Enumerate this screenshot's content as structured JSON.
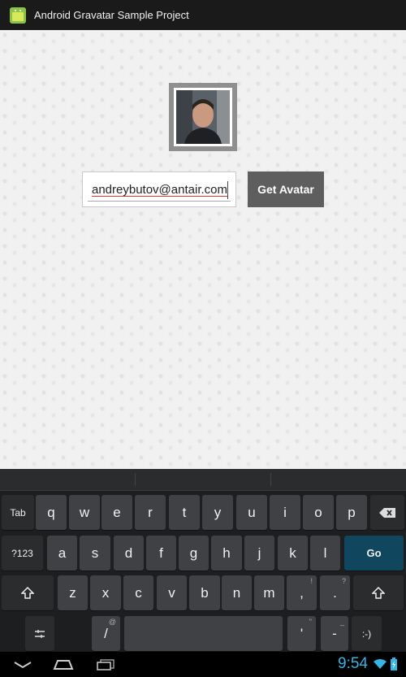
{
  "app": {
    "title": "Android Gravatar Sample Project"
  },
  "form": {
    "email_value": "andreybutov@antair.com",
    "get_avatar_label": "Get Avatar"
  },
  "keyboard": {
    "row1": [
      "Tab",
      "q",
      "w",
      "e",
      "r",
      "t",
      "y",
      "u",
      "i",
      "o",
      "p"
    ],
    "row2": [
      "?123",
      "a",
      "s",
      "d",
      "f",
      "g",
      "h",
      "j",
      "k",
      "l",
      "Go"
    ],
    "row3": [
      "z",
      "x",
      "c",
      "v",
      "b",
      "n",
      "m",
      ",",
      "."
    ],
    "row3_hints": [
      "!",
      "?"
    ],
    "row4": [
      "/",
      "'",
      "-",
      ":-)"
    ],
    "row4_hints": [
      "@",
      "\"",
      "_"
    ]
  },
  "status": {
    "time": "9:54"
  },
  "colors": {
    "accent": "#33b5e5",
    "go_key": "#10465e",
    "button": "#5e5e5e"
  },
  "icons": [
    "android-app-icon",
    "backspace-icon",
    "shift-icon",
    "settings-icon",
    "back-icon",
    "home-icon",
    "recent-apps-icon",
    "wifi-icon",
    "battery-icon"
  ]
}
